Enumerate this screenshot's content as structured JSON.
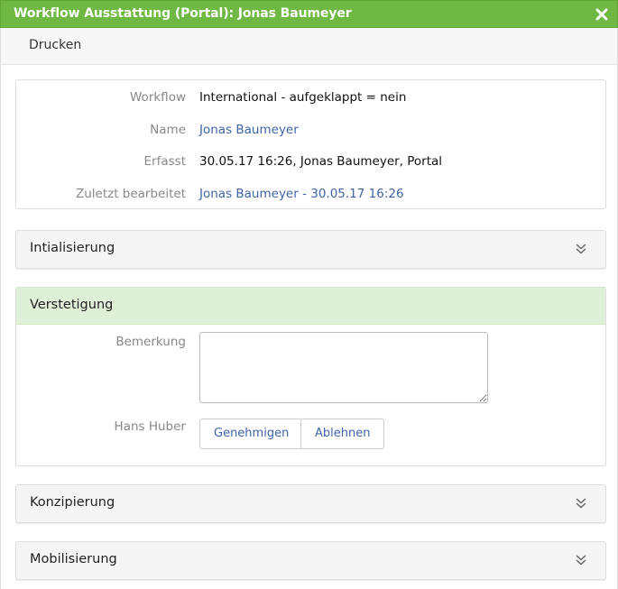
{
  "window": {
    "title": "Workflow Ausstattung (Portal): Jonas Baumeyer",
    "accent_color": "#6eb843",
    "close_icon": "close-icon"
  },
  "toolbar": {
    "print_label": "Drucken"
  },
  "info": {
    "workflow_label": "Workflow",
    "workflow_value": "International - aufgeklappt = nein",
    "name_label": "Name",
    "name_value": "Jonas Baumeyer",
    "created_label": "Erfasst",
    "created_value": "30.05.17 16:26, Jonas Baumeyer, Portal",
    "edited_label": "Zuletzt bearbeitet",
    "edited_value": "Jonas Baumeyer - 30.05.17 16:26"
  },
  "sections": {
    "initialisierung": "Intialisierung",
    "verstetigung": "Verstetigung",
    "konzipierung": "Konzipierung",
    "mobilisierung": "Mobilisierung"
  },
  "verstetigung_form": {
    "remark_label": "Bemerkung",
    "remark_value": "",
    "approver_label": "Hans Huber",
    "approve_label": "Genehmigen",
    "reject_label": "Ablehnen"
  },
  "colors": {
    "open_header_bg": "#dff0d8",
    "link": "#3f63a8"
  }
}
